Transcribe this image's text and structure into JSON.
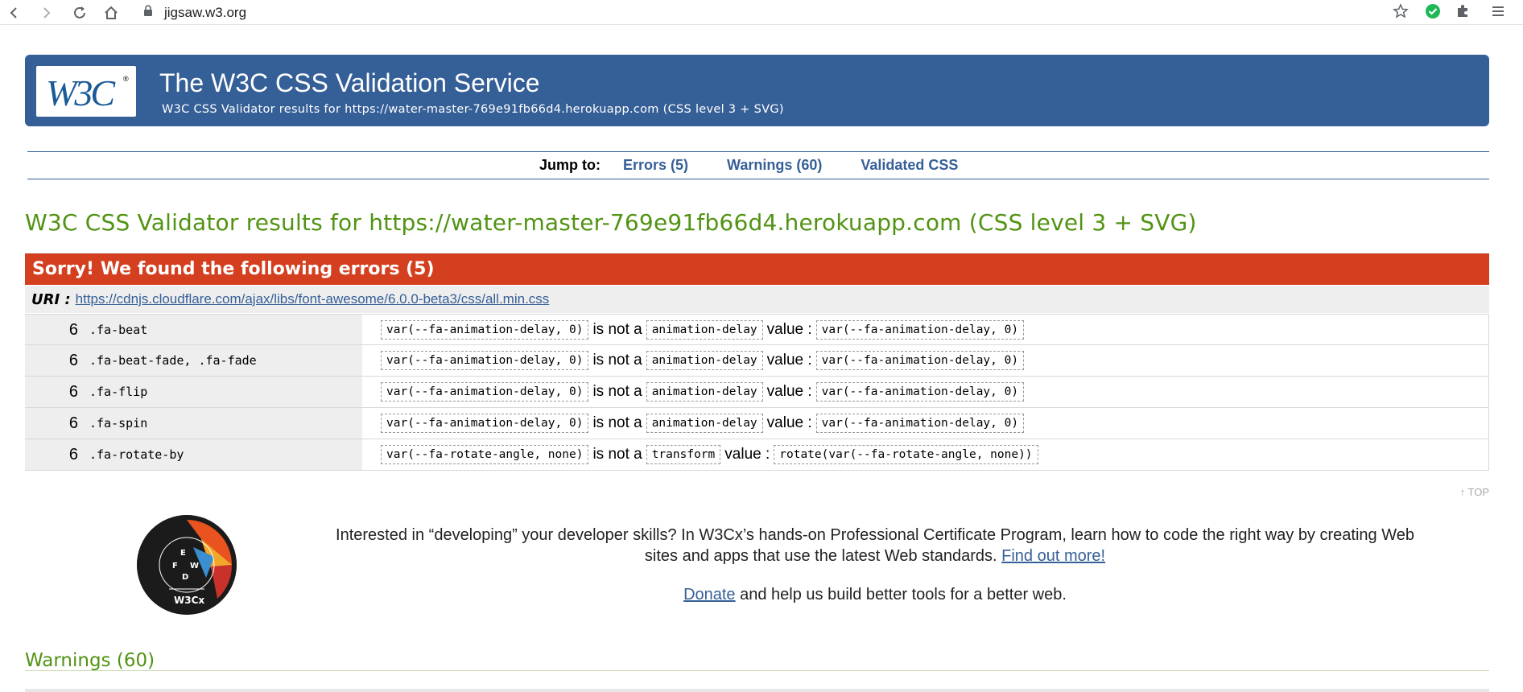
{
  "browser": {
    "url": "jigsaw.w3.org"
  },
  "banner": {
    "logo_text": "W3C",
    "title": "The W3C CSS Validation Service",
    "subtitle": "W3C CSS Validator results for https://water-master-769e91fb66d4.herokuapp.com (CSS level 3 + SVG)"
  },
  "jumpnav": {
    "label": "Jump to:",
    "links": [
      "Errors (5)",
      "Warnings (60)",
      "Validated CSS"
    ]
  },
  "results_heading": "W3C CSS Validator results for https://water-master-769e91fb66d4.herokuapp.com (CSS level 3 + SVG)",
  "errors": {
    "header": "Sorry! We found the following errors (5)",
    "uri_label": "URI :",
    "uri": "https://cdnjs.cloudflare.com/ajax/libs/font-awesome/6.0.0-beta3/css/all.min.css",
    "rows": [
      {
        "line": "6",
        "selector": ".fa-beat",
        "value": "var(--fa-animation-delay, 0)",
        "is_not": "is not a",
        "property": "animation-delay",
        "value_label": "value :",
        "value2": "var(--fa-animation-delay, 0)"
      },
      {
        "line": "6",
        "selector": ".fa-beat-fade, .fa-fade",
        "value": "var(--fa-animation-delay, 0)",
        "is_not": "is not a",
        "property": "animation-delay",
        "value_label": "value :",
        "value2": "var(--fa-animation-delay, 0)"
      },
      {
        "line": "6",
        "selector": ".fa-flip",
        "value": "var(--fa-animation-delay, 0)",
        "is_not": "is not a",
        "property": "animation-delay",
        "value_label": "value :",
        "value2": "var(--fa-animation-delay, 0)"
      },
      {
        "line": "6",
        "selector": ".fa-spin",
        "value": "var(--fa-animation-delay, 0)",
        "is_not": "is not a",
        "property": "animation-delay",
        "value_label": "value :",
        "value2": "var(--fa-animation-delay, 0)"
      },
      {
        "line": "6",
        "selector": ".fa-rotate-by",
        "value": "var(--fa-rotate-angle, none)",
        "is_not": "is not a",
        "property": "transform",
        "value_label": "value :",
        "value2": "rotate(var(--fa-rotate-angle, none))"
      }
    ]
  },
  "top_link": "↑ TOP",
  "promo": {
    "text": "Interested in “developing” your developer skills? In W3Cx’s hands-on Professional Certificate Program, learn how to code the right way by creating Web sites and apps that use the latest Web standards.",
    "link": "Find out more!",
    "donate_link": "Donate",
    "donate_text": " and help us build better tools for a better web.",
    "badge_text": "W3Cx"
  },
  "warnings_heading": "Warnings (60)",
  "colors": {
    "banner": "#355f97",
    "error_bar": "#d43f1f",
    "heading_green": "#519313"
  }
}
